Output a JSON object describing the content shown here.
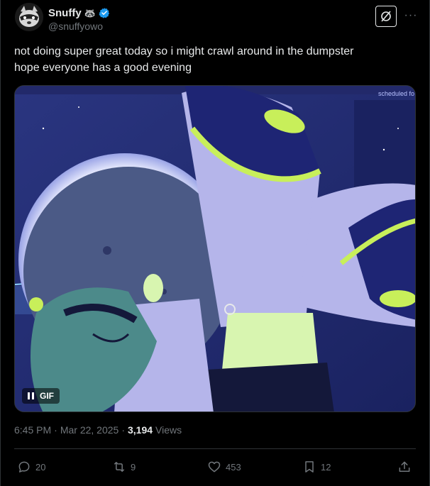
{
  "author": {
    "display_name": "Snuffy",
    "emoji": "🦝",
    "handle": "@snuffyowo",
    "verified": true
  },
  "icons": {
    "grok": "grok-icon",
    "more": "more-icon",
    "verified": "verified-badge-icon",
    "pause": "pause-icon",
    "reply": "reply-icon",
    "retweet": "retweet-icon",
    "like": "like-icon",
    "bookmark": "bookmark-icon",
    "share": "share-icon"
  },
  "tweet": {
    "text_line1": "not doing super great today so i might crawl around in the dumpster",
    "text_line2": "hope everyone has a good evening"
  },
  "media": {
    "badge": "GIF",
    "overlay_text": "scheduled fo"
  },
  "meta": {
    "time": "6:45 PM",
    "separator": "·",
    "date": "Mar 22, 2025",
    "views_count": "3,194",
    "views_label": "Views"
  },
  "actions": {
    "replies": "20",
    "retweets": "9",
    "likes": "453",
    "bookmarks": "12"
  },
  "colors": {
    "background": "#000000",
    "text": "#e7e9ea",
    "secondary": "#71767b",
    "border": "#2f3336",
    "verified": "#1d9bf0"
  }
}
